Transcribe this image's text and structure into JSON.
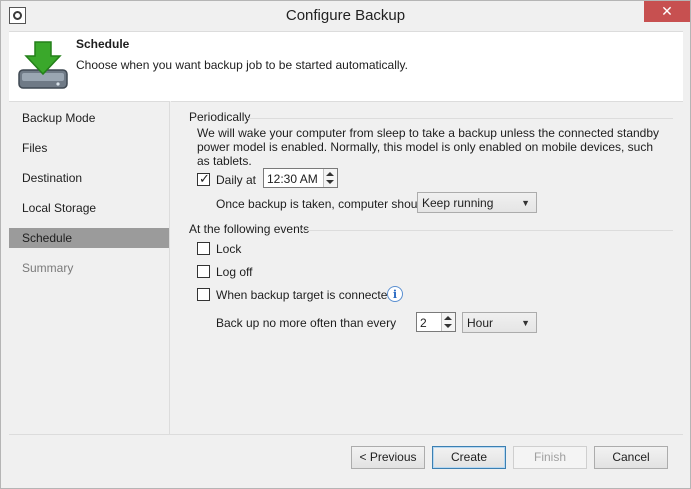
{
  "window": {
    "title": "Configure Backup",
    "close_glyph": "✕"
  },
  "header": {
    "title": "Schedule",
    "description": "Choose when you want backup job to be started automatically."
  },
  "nav": {
    "items": [
      {
        "label": "Backup Mode"
      },
      {
        "label": "Files"
      },
      {
        "label": "Destination"
      },
      {
        "label": "Local Storage"
      },
      {
        "label": "Schedule",
        "selected": true
      },
      {
        "label": "Summary",
        "disabled": true
      }
    ]
  },
  "periodically": {
    "title": "Periodically",
    "note": "We will wake your computer from sleep to take a backup unless the connected standby power model is enabled. Normally, this model is only enabled on mobile devices, such as tablets.",
    "daily_label": "Daily at",
    "daily_checked": true,
    "daily_time": "12:30 AM",
    "after_label": "Once backup is taken, computer should",
    "after_value": "Keep running"
  },
  "events": {
    "title": "At the following events",
    "lock_label": "Lock",
    "logoff_label": "Log off",
    "target_label": "When backup target is connected",
    "info_glyph": "i",
    "often_label": "Back up no more often than every",
    "often_value": "2",
    "often_unit": "Hour"
  },
  "footer": {
    "previous": "< Previous",
    "create": "Create",
    "finish": "Finish",
    "cancel": "Cancel"
  },
  "colors": {
    "selected_nav": "#9b9b9b",
    "close_button": "#c75050",
    "arrow_green": "#3aa82b"
  }
}
